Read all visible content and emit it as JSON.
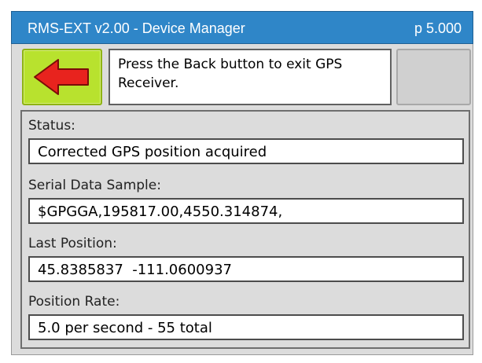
{
  "titlebar": {
    "title": "RMS-EXT v2.00 - Device Manager",
    "page": "p 5.000"
  },
  "back_button": {
    "icon": "left-arrow-icon",
    "bg_color": "#b8e22e",
    "arrow_color": "#e8231e"
  },
  "message": "Press the Back button to exit GPS Receiver.",
  "fields": [
    {
      "label": "Status:",
      "value": "Corrected GPS position acquired"
    },
    {
      "label": "Serial Data Sample:",
      "value": "$GPGGA,195817.00,4550.314874,"
    },
    {
      "label": "Last Position:",
      "value": "45.8385837  -111.0600937"
    },
    {
      "label": "Position Rate:",
      "value": "5.0 per second - 55 total"
    }
  ],
  "colors": {
    "titlebar": "#2f86c8",
    "panel": "#dcdcdc"
  }
}
